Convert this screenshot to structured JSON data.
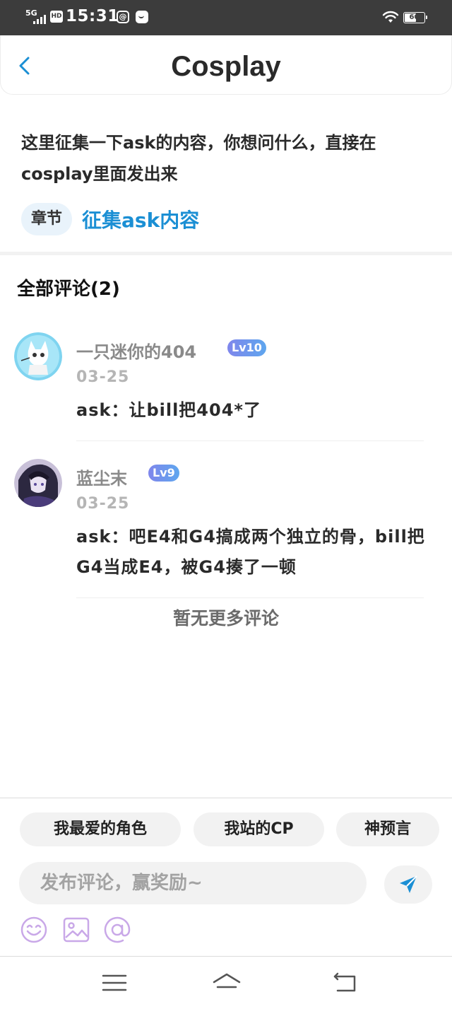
{
  "status_bar": {
    "signal": "5G",
    "hd": "HD",
    "time": "15:31",
    "circle_icon_glyph": "@",
    "battery": "60",
    "battery_level": 0.6
  },
  "header": {
    "title": "Cosplay",
    "back_icon": "chevron-left-icon"
  },
  "post": {
    "description": "这里征集一下ask的内容，你想问什么，直接在cosplay里面发出来",
    "chapter_badge": "章节",
    "chapter_title": "征集ask内容"
  },
  "comments_section": {
    "heading": "全部评论(2)",
    "no_more": "暂无更多评论",
    "items": [
      {
        "username": "一只迷你的404",
        "level": "Lv10",
        "date": "03-25",
        "text": "ask：让bill把404*了"
      },
      {
        "username": "蓝尘末",
        "level": "Lv9",
        "date": "03-25",
        "text": "ask：吧E4和G4搞成两个独立的骨，bill把G4当成E4，被G4揍了一顿"
      }
    ]
  },
  "bottom_panel": {
    "chips": [
      "我最爱的角色",
      "我站的CP",
      "神预言"
    ],
    "input_placeholder": "发布评论，赢奖励~",
    "send_icon": "send-icon",
    "tools": [
      "emoji-icon",
      "image-icon",
      "mention-icon"
    ]
  },
  "colors": {
    "accent": "#1b8fd4",
    "level_badge_start": "#7f86ec",
    "level_badge_end": "#5ea6ee",
    "tool_icon": "#c9a8e8",
    "status_bar_bg": "#3c3c3c"
  },
  "navbar": {
    "icons": [
      "menu-icon",
      "home-icon",
      "back-nav-icon"
    ]
  }
}
